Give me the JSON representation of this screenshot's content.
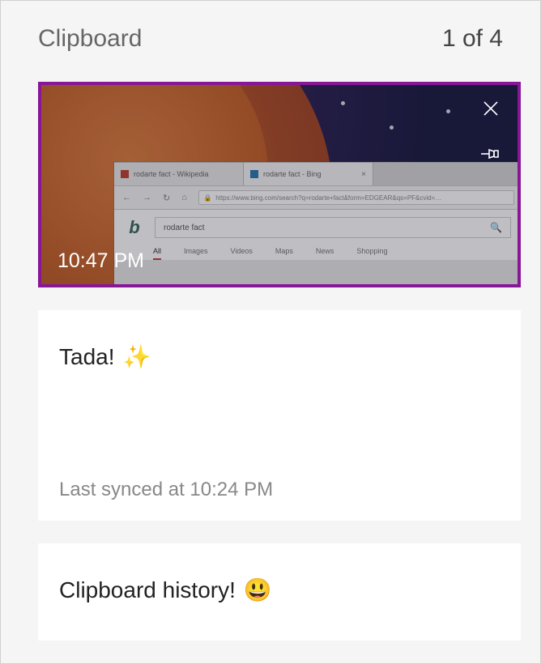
{
  "header": {
    "title": "Clipboard",
    "position_label": "1 of 4"
  },
  "items": [
    {
      "kind": "image",
      "selected": true,
      "timestamp": "10:47 PM",
      "actions": {
        "close_icon": "close-icon",
        "pin_icon": "pin-icon"
      }
    },
    {
      "kind": "text",
      "content": "Tada!",
      "emoji": "✨",
      "meta": "Last synced at 10:24 PM"
    },
    {
      "kind": "text",
      "content": "Clipboard history!",
      "emoji": "😃"
    }
  ]
}
